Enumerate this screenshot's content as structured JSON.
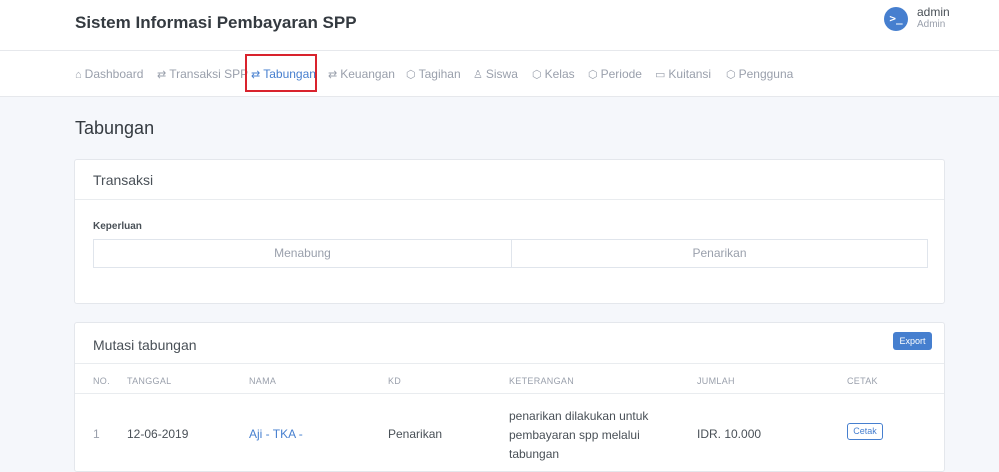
{
  "header": {
    "title": "Sistem Informasi Pembayaran SPP",
    "avatar_glyph": ">_",
    "user_name": "admin",
    "user_role": "Admin"
  },
  "nav": {
    "items": [
      {
        "label": "Dashboard",
        "icon": "home-icon",
        "glyph": "⌂"
      },
      {
        "label": "Transaksi SPP",
        "icon": "exchange-icon",
        "glyph": "⇄"
      },
      {
        "label": "Tabungan",
        "icon": "exchange-icon",
        "glyph": "⇄"
      },
      {
        "label": "Keuangan",
        "icon": "exchange-icon",
        "glyph": "⇄"
      },
      {
        "label": "Tagihan",
        "icon": "box-icon",
        "glyph": "⬡"
      },
      {
        "label": "Siswa",
        "icon": "users-icon",
        "glyph": "♙"
      },
      {
        "label": "Kelas",
        "icon": "box-icon",
        "glyph": "⬡"
      },
      {
        "label": "Periode",
        "icon": "box-icon",
        "glyph": "⬡"
      },
      {
        "label": "Kuitansi",
        "icon": "folder-icon",
        "glyph": "▭"
      },
      {
        "label": "Pengguna",
        "icon": "box-icon",
        "glyph": "⬡"
      }
    ],
    "active": "Tabungan"
  },
  "page": {
    "title": "Tabungan"
  },
  "transaksi": {
    "title": "Transaksi",
    "field_label": "Keperluan",
    "options": [
      "Menabung",
      "Penarikan"
    ]
  },
  "mutasi": {
    "title": "Mutasi tabungan",
    "export_label": "Export",
    "columns": [
      "NO.",
      "TANGGAL",
      "NAMA",
      "KD",
      "KETERANGAN",
      "JUMLAH",
      "CETAK"
    ],
    "rows": [
      {
        "no": "1",
        "tanggal": "12-06-2019",
        "nama": "Aji - TKA -",
        "kd": "Penarikan",
        "keterangan": "penarikan dilakukan untuk pembayaran spp melalui tabungan",
        "jumlah": "IDR. 10.000",
        "cetak": "Cetak"
      }
    ]
  },
  "colors": {
    "accent": "#467fcf",
    "highlight": "#d9232d",
    "background": "#f5f7fb"
  }
}
